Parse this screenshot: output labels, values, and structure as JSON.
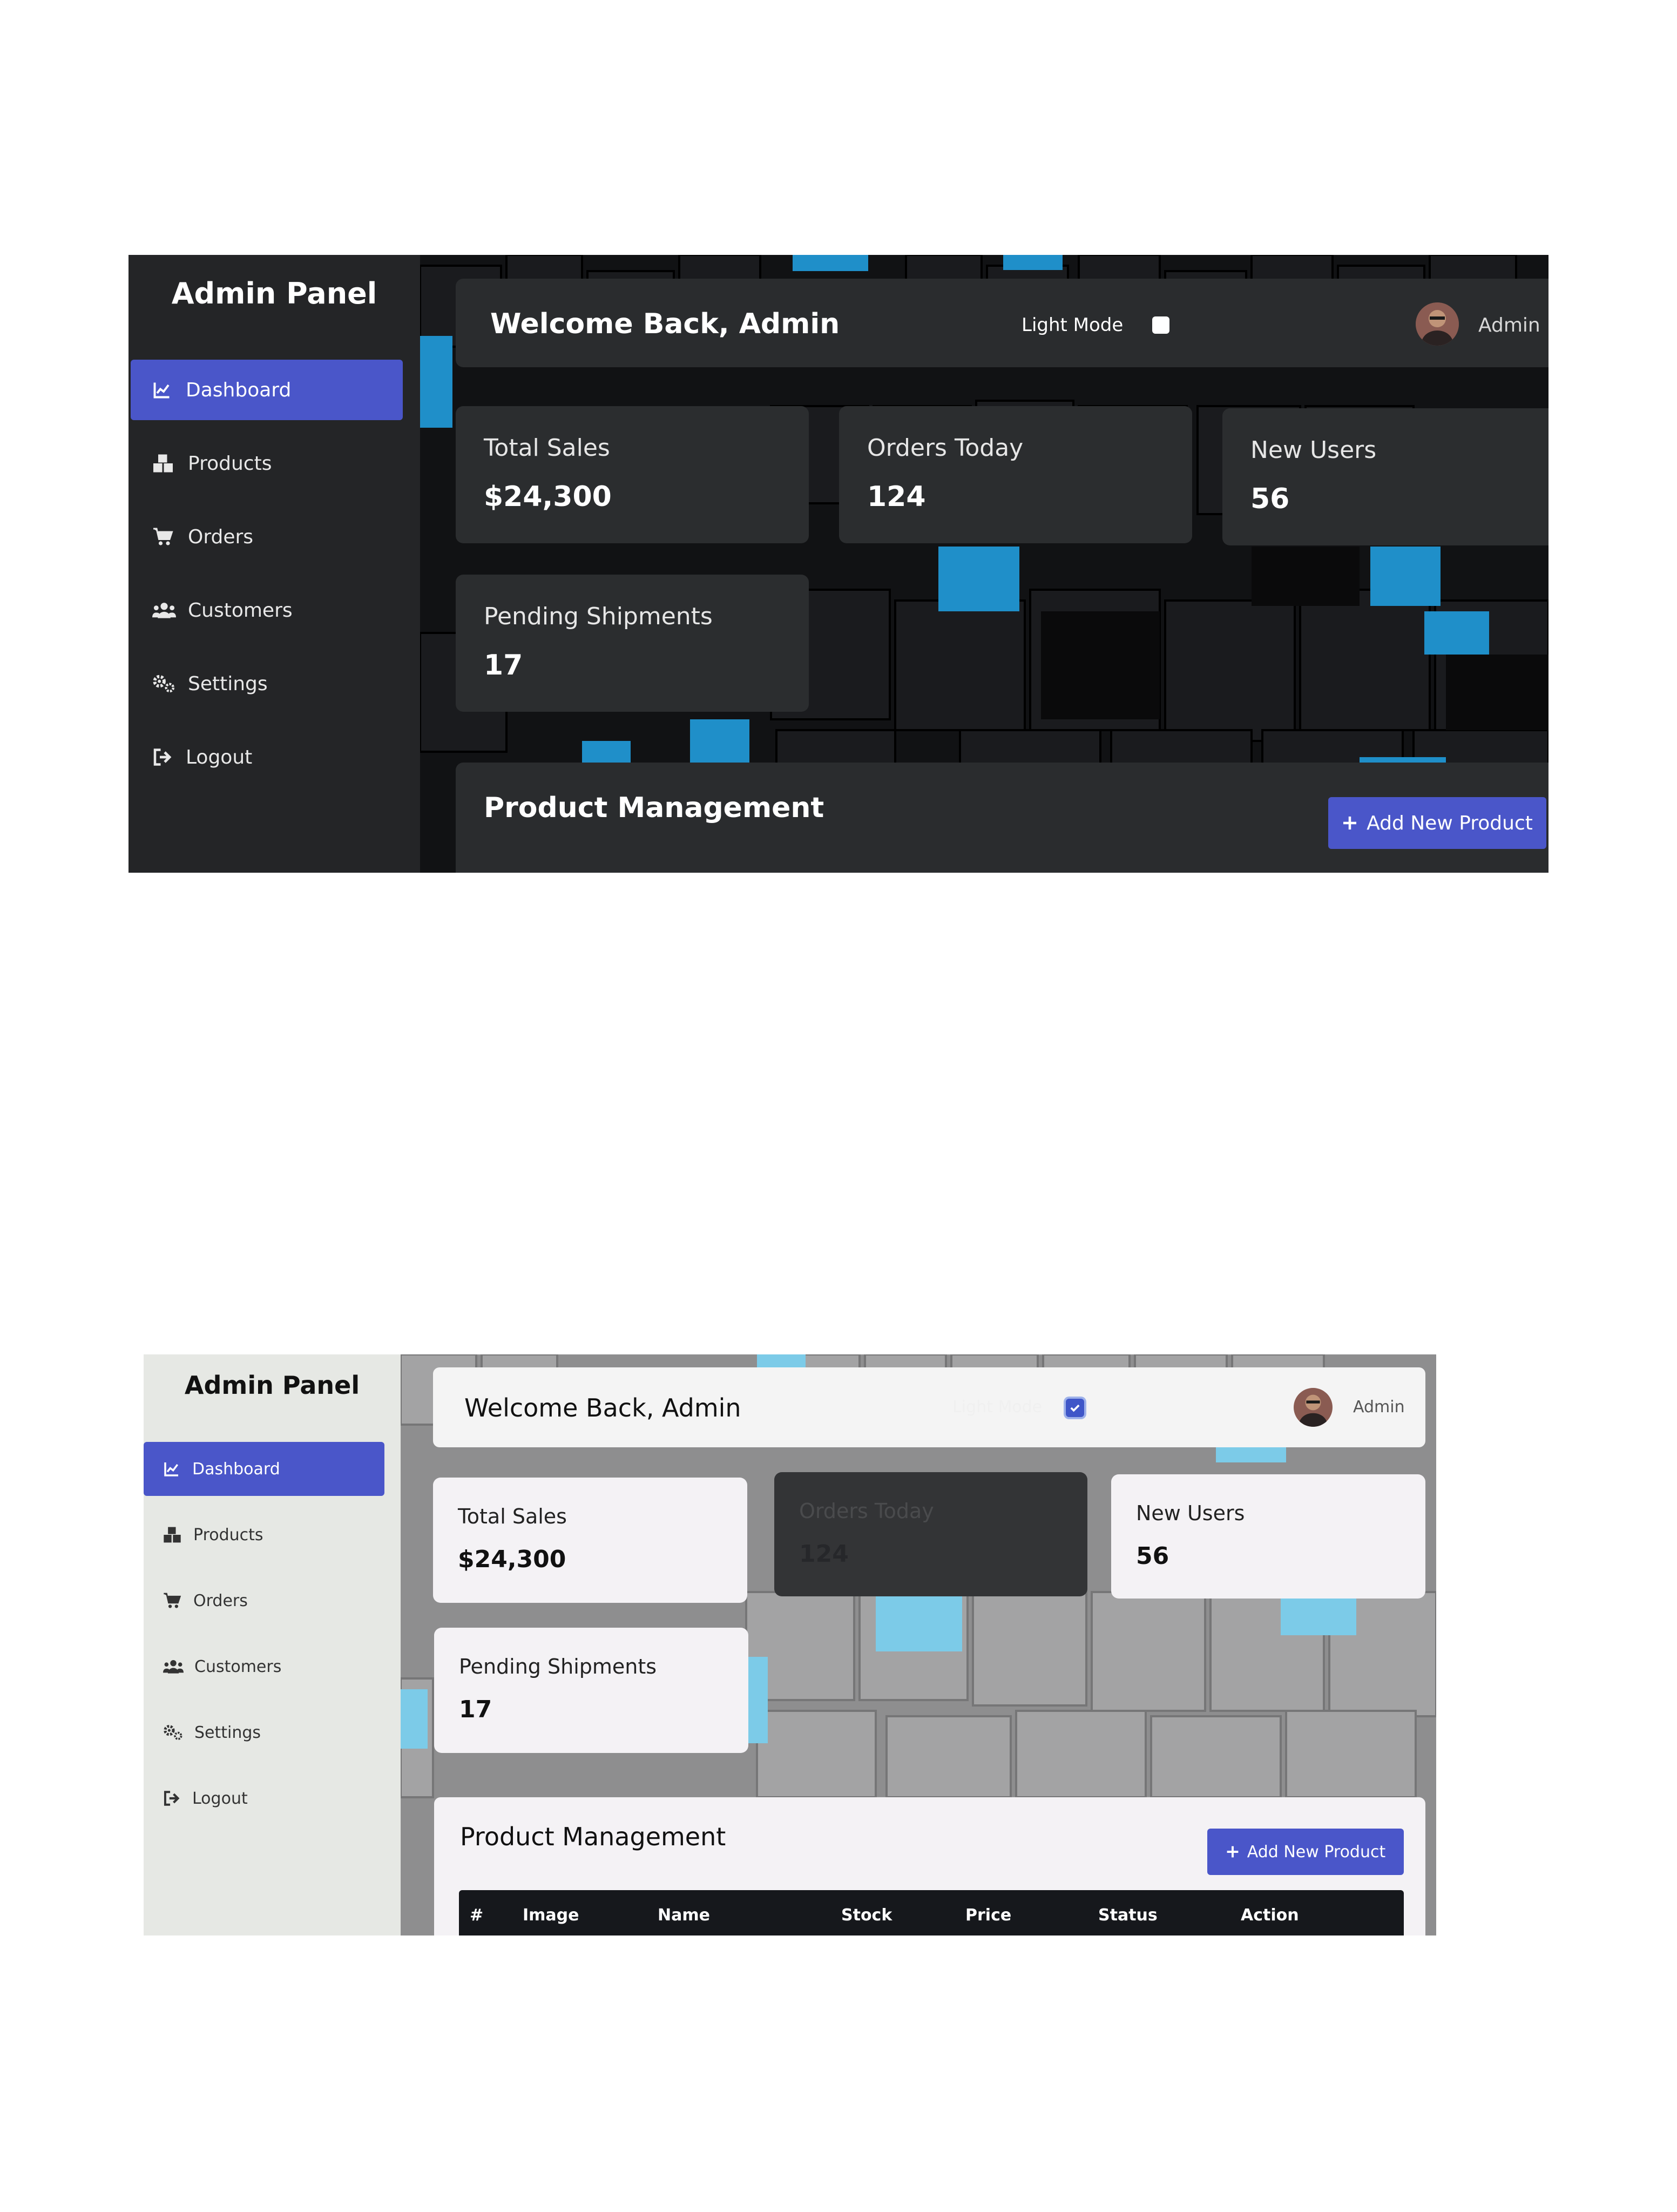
{
  "sidebar": {
    "title": "Admin Panel",
    "items": [
      {
        "label": "Dashboard",
        "icon": "chart-line-icon",
        "active": true
      },
      {
        "label": "Products",
        "icon": "boxes-icon",
        "active": false
      },
      {
        "label": "Orders",
        "icon": "cart-icon",
        "active": false
      },
      {
        "label": "Customers",
        "icon": "users-icon",
        "active": false
      },
      {
        "label": "Settings",
        "icon": "gears-icon",
        "active": false
      },
      {
        "label": "Logout",
        "icon": "logout-icon",
        "active": false
      }
    ]
  },
  "header": {
    "welcome": "Welcome Back, Admin",
    "light_mode_label": "Light Mode",
    "user_name": "Admin"
  },
  "stats": [
    {
      "label": "Total Sales",
      "value": "$24,300"
    },
    {
      "label": "Orders Today",
      "value": "124"
    },
    {
      "label": "New Users",
      "value": "56"
    },
    {
      "label": "Pending Shipments",
      "value": "17"
    }
  ],
  "products": {
    "title": "Product Management",
    "add_button": "+ Add New Product",
    "add_button_text": "Add New Product",
    "columns": [
      "#",
      "Image",
      "Name",
      "Stock",
      "Price",
      "Status",
      "Action"
    ]
  },
  "screens": {
    "top": {
      "theme": "dark",
      "light_mode_checked": false
    },
    "bottom": {
      "theme": "light",
      "light_mode_checked": true
    }
  },
  "colors": {
    "accent": "#4a56c9",
    "dark_sidebar": "#242527",
    "dark_panel": "#2a2c2e",
    "light_sidebar": "#e6e8e4",
    "light_panel": "#f4f2f5",
    "cyan_tile": "#1f8fc9"
  }
}
